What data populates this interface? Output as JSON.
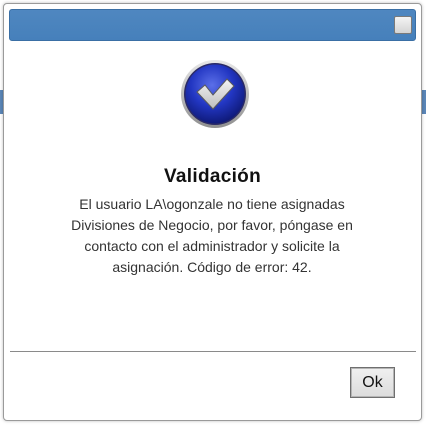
{
  "dialog": {
    "title": "Validación",
    "message": "El usuario LA\\ogonzale no tiene asignadas Divisiones de Negocio, por favor, póngase en contacto con el administrador y solicite la asignación. Código de error: 42.",
    "icon": "check-shield-icon",
    "ok_label": "Ok",
    "close_icon": "close-box-icon"
  },
  "colors": {
    "title_bar": "#4680bb",
    "icon_blue": "#1c2fb0",
    "icon_check": "#d9d9d9"
  }
}
